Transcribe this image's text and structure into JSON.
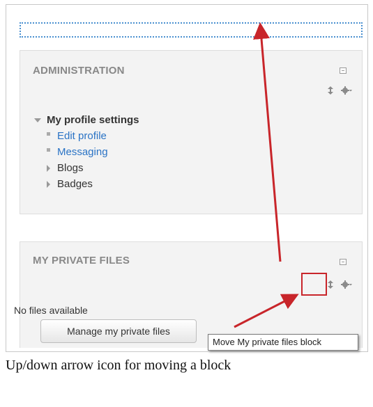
{
  "administration": {
    "title": "ADMINISTRATION",
    "section": "My profile settings",
    "items": [
      {
        "label": "Edit profile",
        "kind": "link"
      },
      {
        "label": "Messaging",
        "kind": "link"
      },
      {
        "label": "Blogs",
        "kind": "collapsed"
      },
      {
        "label": "Badges",
        "kind": "collapsed"
      }
    ]
  },
  "private_files": {
    "title": "MY PRIVATE FILES",
    "status_text": "No files available",
    "manage_button": "Manage my private files"
  },
  "tooltip": {
    "text": "Move My private files block"
  },
  "caption": "Up/down arrow icon for moving a block",
  "colors": {
    "link": "#2a73c5",
    "annotation_red": "#c8252a",
    "dropzone_blue": "#4a90d0"
  },
  "icons": [
    "collapse-icon",
    "move-icon",
    "gear-icon"
  ]
}
